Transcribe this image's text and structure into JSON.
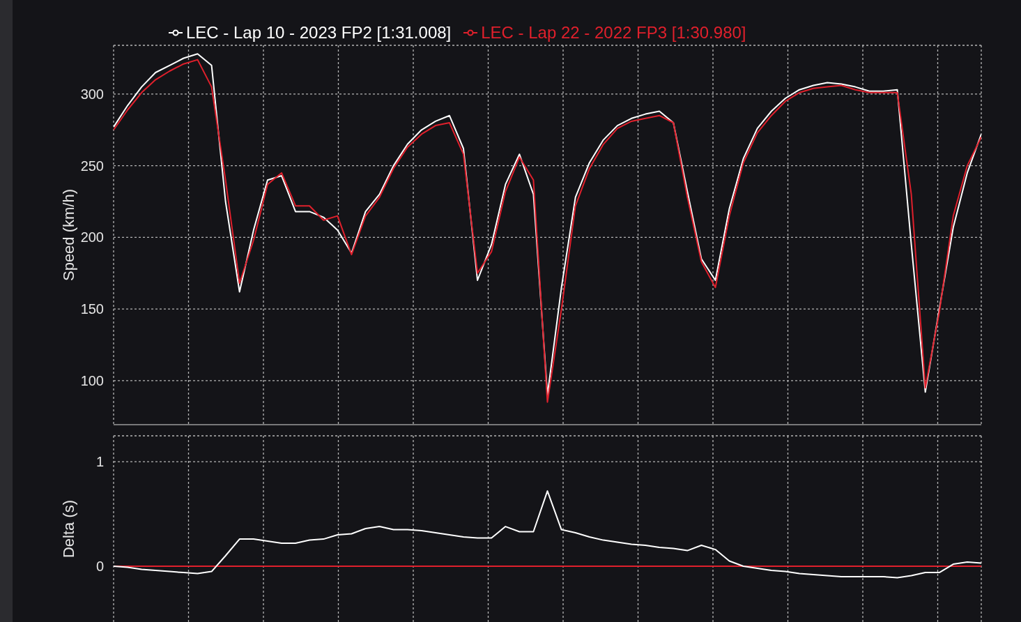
{
  "speed_chart": {
    "chart_data": {
      "type": "line",
      "grid": true,
      "legend": true,
      "ylabel": "Speed (km/h)",
      "ylim": [
        69.3,
        334
      ],
      "yticks": [
        100,
        150,
        200,
        250,
        300
      ],
      "series": [
        {
          "name": "LEC - Lap 10 - 2023 FP2 [1:31.008]",
          "color": "#ffffff",
          "values": [
            277,
            292,
            305,
            315,
            320,
            325,
            328,
            320,
            225,
            162,
            205,
            240,
            243,
            218,
            218,
            214,
            205,
            189,
            218,
            230,
            250,
            265,
            275,
            281,
            285,
            262,
            170,
            195,
            237,
            258,
            230,
            90,
            165,
            228,
            252,
            268,
            278,
            283,
            286,
            288,
            280,
            232,
            185,
            170,
            220,
            255,
            276,
            288,
            297,
            303,
            306,
            308,
            307,
            305,
            302,
            302,
            303,
            195,
            92,
            150,
            207,
            245,
            272
          ]
        },
        {
          "name": "LEC - Lap 22 - 2022 FP3 [1:30.980]",
          "color": "#e0202c",
          "values": [
            275,
            289,
            301,
            310,
            316,
            321,
            324,
            305,
            240,
            168,
            198,
            237,
            245,
            222,
            222,
            212,
            215,
            188,
            215,
            228,
            248,
            263,
            272,
            278,
            280,
            258,
            175,
            190,
            232,
            256,
            240,
            85,
            150,
            222,
            248,
            265,
            276,
            281,
            283,
            285,
            280,
            228,
            183,
            165,
            215,
            252,
            273,
            285,
            295,
            301,
            304,
            305,
            306,
            303,
            301,
            301,
            301,
            230,
            95,
            148,
            215,
            250,
            270
          ]
        }
      ]
    }
  },
  "delta_chart": {
    "chart_data": {
      "type": "line",
      "grid": true,
      "ylabel": "Delta (s)",
      "ylim": [
        -0.533,
        1.247
      ],
      "yticks": [
        0,
        1
      ],
      "series": [
        {
          "color": "#e0202c",
          "values": [
            0,
            0,
            0,
            0,
            0,
            0,
            0,
            0,
            0,
            0,
            0,
            0,
            0,
            0,
            0,
            0,
            0,
            0,
            0,
            0,
            0,
            0,
            0,
            0,
            0,
            0,
            0,
            0,
            0,
            0,
            0,
            0,
            0,
            0,
            0,
            0,
            0,
            0,
            0,
            0,
            0,
            0,
            0,
            0,
            0,
            0,
            0,
            0,
            0,
            0,
            0,
            0,
            0,
            0,
            0,
            0,
            0,
            0,
            0,
            0,
            0,
            0,
            0
          ]
        },
        {
          "color": "#ffffff",
          "values": [
            0,
            -0.01,
            -0.03,
            -0.04,
            -0.05,
            -0.06,
            -0.07,
            -0.05,
            0.1,
            0.26,
            0.26,
            0.24,
            0.22,
            0.22,
            0.25,
            0.26,
            0.3,
            0.31,
            0.36,
            0.38,
            0.35,
            0.35,
            0.34,
            0.32,
            0.3,
            0.28,
            0.27,
            0.27,
            0.38,
            0.33,
            0.33,
            0.72,
            0.35,
            0.32,
            0.28,
            0.25,
            0.23,
            0.21,
            0.2,
            0.18,
            0.17,
            0.15,
            0.2,
            0.16,
            0.05,
            0,
            -0.02,
            -0.04,
            -0.05,
            -0.07,
            -0.08,
            -0.09,
            -0.1,
            -0.1,
            -0.1,
            -0.1,
            -0.11,
            -0.09,
            -0.06,
            -0.06,
            0.02,
            0.04,
            0.03
          ]
        }
      ]
    }
  }
}
